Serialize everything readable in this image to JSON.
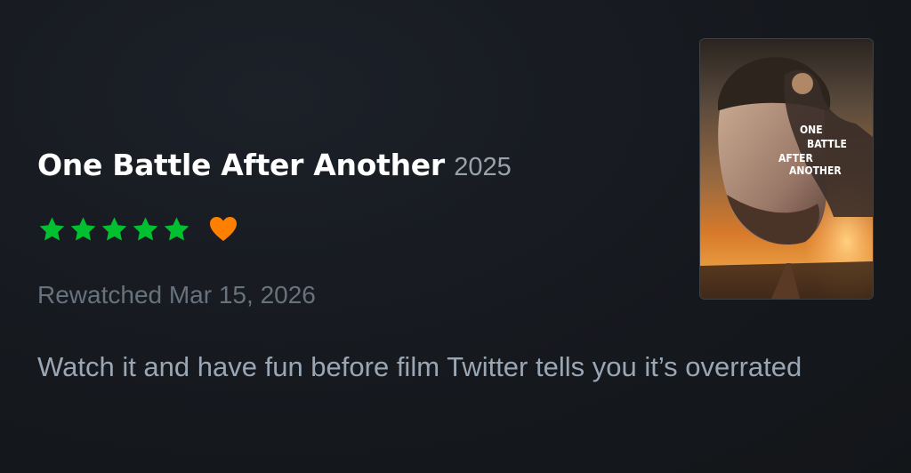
{
  "film": {
    "title": "One Battle After Another",
    "year": "2025"
  },
  "rating": {
    "stars": 5,
    "max_stars": 5,
    "star_color": "#00c030",
    "liked": true,
    "heart_color": "#ff8000",
    "star_icon": "star-icon",
    "heart_icon": "heart-icon"
  },
  "activity": {
    "label": "Rewatched Mar 15, 2026"
  },
  "review": {
    "text": "Watch it and have fun before film Twitter tells you it’s overrated"
  },
  "poster": {
    "title_lines": [
      "ONE",
      "BATTLE",
      "AFTER",
      "ANOTHER"
    ]
  }
}
